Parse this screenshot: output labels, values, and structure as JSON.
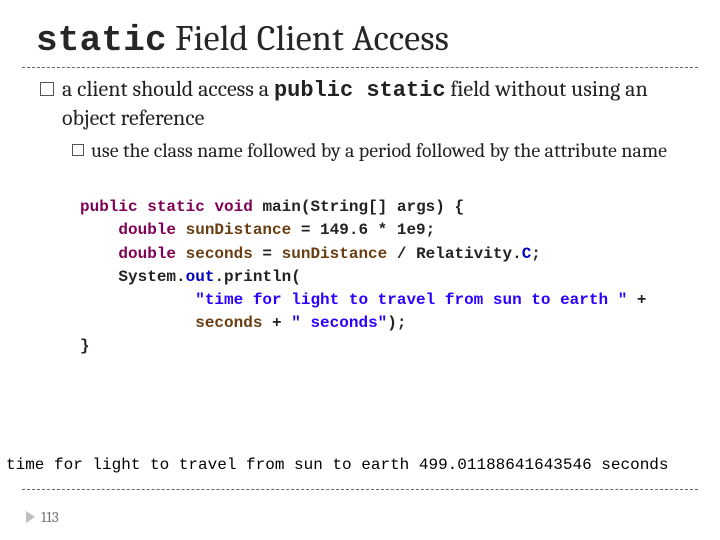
{
  "title": {
    "prefix": "static",
    "rest": " Field Client Access"
  },
  "bullet1": {
    "seg1": "a client should access a ",
    "mono": "public static",
    "seg2": " field without using an object reference"
  },
  "bullet2": {
    "text": "use the class name followed by a period followed by the attribute name"
  },
  "code": {
    "l1_kw1": "public",
    "l1_kw2": "static",
    "l1_kw3": "void",
    "l1_rest": " main(String[] args) {",
    "l2_kw": "double",
    "l2_var": " sunDistance",
    "l2_rest": " = 149.6 * 1e9;",
    "l3_kw": "double",
    "l3_var": " seconds",
    "l3_mid": " = ",
    "l3_var2": "sunDistance",
    "l3_mid2": " / Relativity.",
    "l3_mem": "C",
    "l3_end": ";",
    "l4a": "    System.",
    "l4_mem": "out",
    "l4b": ".println(",
    "l5_str": "\"time for light to travel from sun to earth \"",
    "l5_plus": " +",
    "l6_var": "seconds",
    "l6_mid": " + ",
    "l6_str": "\" seconds\"",
    "l6_end": ");",
    "l7": "}"
  },
  "output": "time for light to travel from sun to earth 499.01188641643546 seconds",
  "page": "113"
}
